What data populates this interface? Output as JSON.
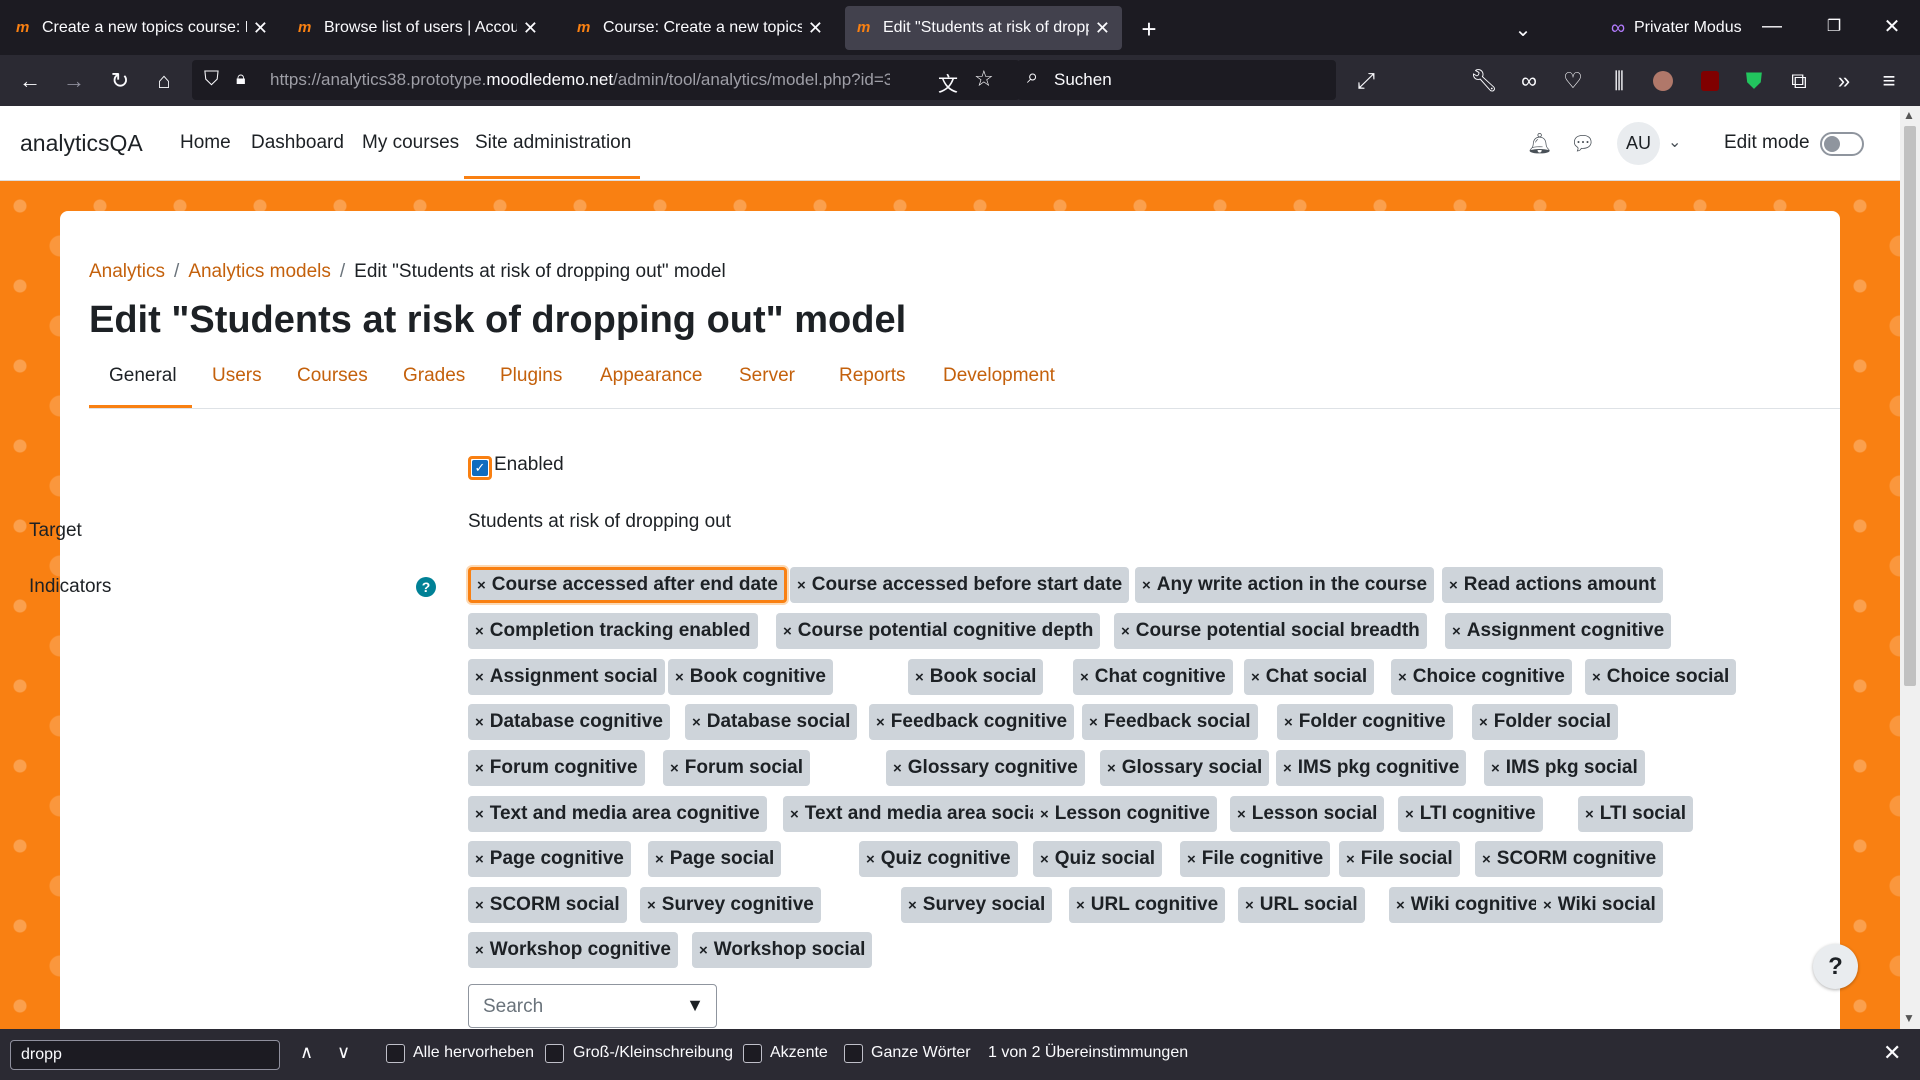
{
  "browser": {
    "tabs": [
      {
        "title": "Create a new topics course: Log",
        "active": false
      },
      {
        "title": "Browse list of users | Accounts |",
        "active": false
      },
      {
        "title": "Course: Create a new topics cou",
        "active": false
      },
      {
        "title": "Edit \"Students at risk of droppin",
        "active": true
      }
    ],
    "private_mode_label": "Privater Modus",
    "url_prefix": "https://analytics38.prototype.",
    "url_domain": "moodledemo.net",
    "url_path": "/admin/tool/analytics/model.php?id=3",
    "search_placeholder": "Suchen"
  },
  "moodle": {
    "brand": "analyticsQA",
    "primary_nav": [
      "Home",
      "Dashboard",
      "My courses",
      "Site administration"
    ],
    "avatar_initials": "AU",
    "edit_mode_label": "Edit mode",
    "breadcrumb": {
      "link1": "Analytics",
      "link2": "Analytics models",
      "current": "Edit \"Students at risk of dropping out\" model"
    },
    "page_title": "Edit \"Students at risk of dropping out\" model",
    "secondary_tabs": [
      "General",
      "Users",
      "Courses",
      "Grades",
      "Plugins",
      "Appearance",
      "Server",
      "Reports",
      "Development"
    ],
    "form": {
      "enabled_label": "Enabled",
      "enabled_checked": true,
      "target_label": "Target",
      "target_value": "Students at risk of dropping out",
      "indicators_label": "Indicators",
      "search_placeholder": "Search",
      "help_glyph": "?"
    },
    "chip_remove_glyph": "×",
    "indicator_rows": [
      [
        "Course accessed after end date",
        "Course accessed before start date",
        "Any write action in the course",
        "Read actions amount"
      ],
      [
        "Completion tracking enabled",
        "Course potential cognitive depth",
        "Course potential social breadth",
        "Assignment cognitive"
      ],
      [
        "Assignment social",
        "Book cognitive",
        "Book social",
        "Chat cognitive",
        "Chat social",
        "Choice cognitive",
        "Choice social"
      ],
      [
        "Database cognitive",
        "Database social",
        "Feedback cognitive",
        "Feedback social",
        "Folder cognitive",
        "Folder social"
      ],
      [
        "Forum cognitive",
        "Forum social",
        "Glossary cognitive",
        "Glossary social",
        "IMS pkg cognitive",
        "IMS pkg social"
      ],
      [
        "Text and media area cognitive",
        "Text and media area social",
        "Lesson cognitive",
        "Lesson social",
        "LTI cognitive",
        "LTI social"
      ],
      [
        "Page cognitive",
        "Page social",
        "Quiz cognitive",
        "Quiz social",
        "File cognitive",
        "File social",
        "SCORM cognitive"
      ],
      [
        "SCORM social",
        "Survey cognitive",
        "Survey social",
        "URL cognitive",
        "URL social",
        "Wiki cognitive",
        "Wiki social"
      ],
      [
        "Workshop cognitive",
        "Workshop social"
      ]
    ],
    "page_help": "?"
  },
  "findbar": {
    "query": "dropp",
    "highlight_all": "Alle hervorheben",
    "match_case": "Groß-/Kleinschreibung",
    "match_diacritics": "Akzente",
    "whole_words": "Ganze Wörter",
    "status": "1 von 2 Übereinstimmungen"
  },
  "colors": {
    "accent": "#f98012",
    "link": "#c4610c",
    "chip_bg": "#ced4da",
    "checkbox": "#0f6cbf"
  }
}
